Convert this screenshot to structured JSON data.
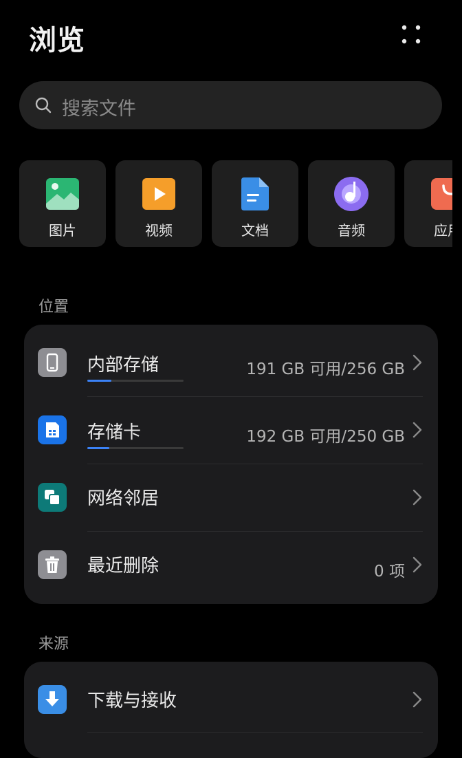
{
  "header": {
    "title": "浏览"
  },
  "search": {
    "placeholder": "搜索文件"
  },
  "categories": [
    {
      "label": "图片",
      "icon": "image-icon",
      "color": "#2bb673"
    },
    {
      "label": "视频",
      "icon": "video-icon",
      "color": "#f59e2a"
    },
    {
      "label": "文档",
      "icon": "document-icon",
      "color": "#3a8ee6"
    },
    {
      "label": "音频",
      "icon": "audio-icon",
      "color": "#8b6cf0"
    },
    {
      "label": "应用",
      "icon": "app-icon",
      "color": "#ef6b50"
    }
  ],
  "location": {
    "title": "位置",
    "items": [
      {
        "name": "内部存储",
        "meta": "191 GB 可用/256 GB",
        "used_fraction": 0.25,
        "icon": "phone-icon",
        "color": "#8e8e93"
      },
      {
        "name": "存储卡",
        "meta": "192 GB 可用/250 GB",
        "used_fraction": 0.23,
        "icon": "sd-card-icon",
        "color": "#1a73e8"
      },
      {
        "name": "网络邻居",
        "meta": "",
        "icon": "network-icon",
        "color": "#0d7a78"
      },
      {
        "name": "最近删除",
        "meta": "0 项",
        "icon": "trash-icon",
        "color": "#8e8e93"
      }
    ]
  },
  "source": {
    "title": "来源",
    "items": [
      {
        "name": "下载与接收",
        "icon": "download-icon",
        "color": "#3a8ee6"
      }
    ]
  }
}
